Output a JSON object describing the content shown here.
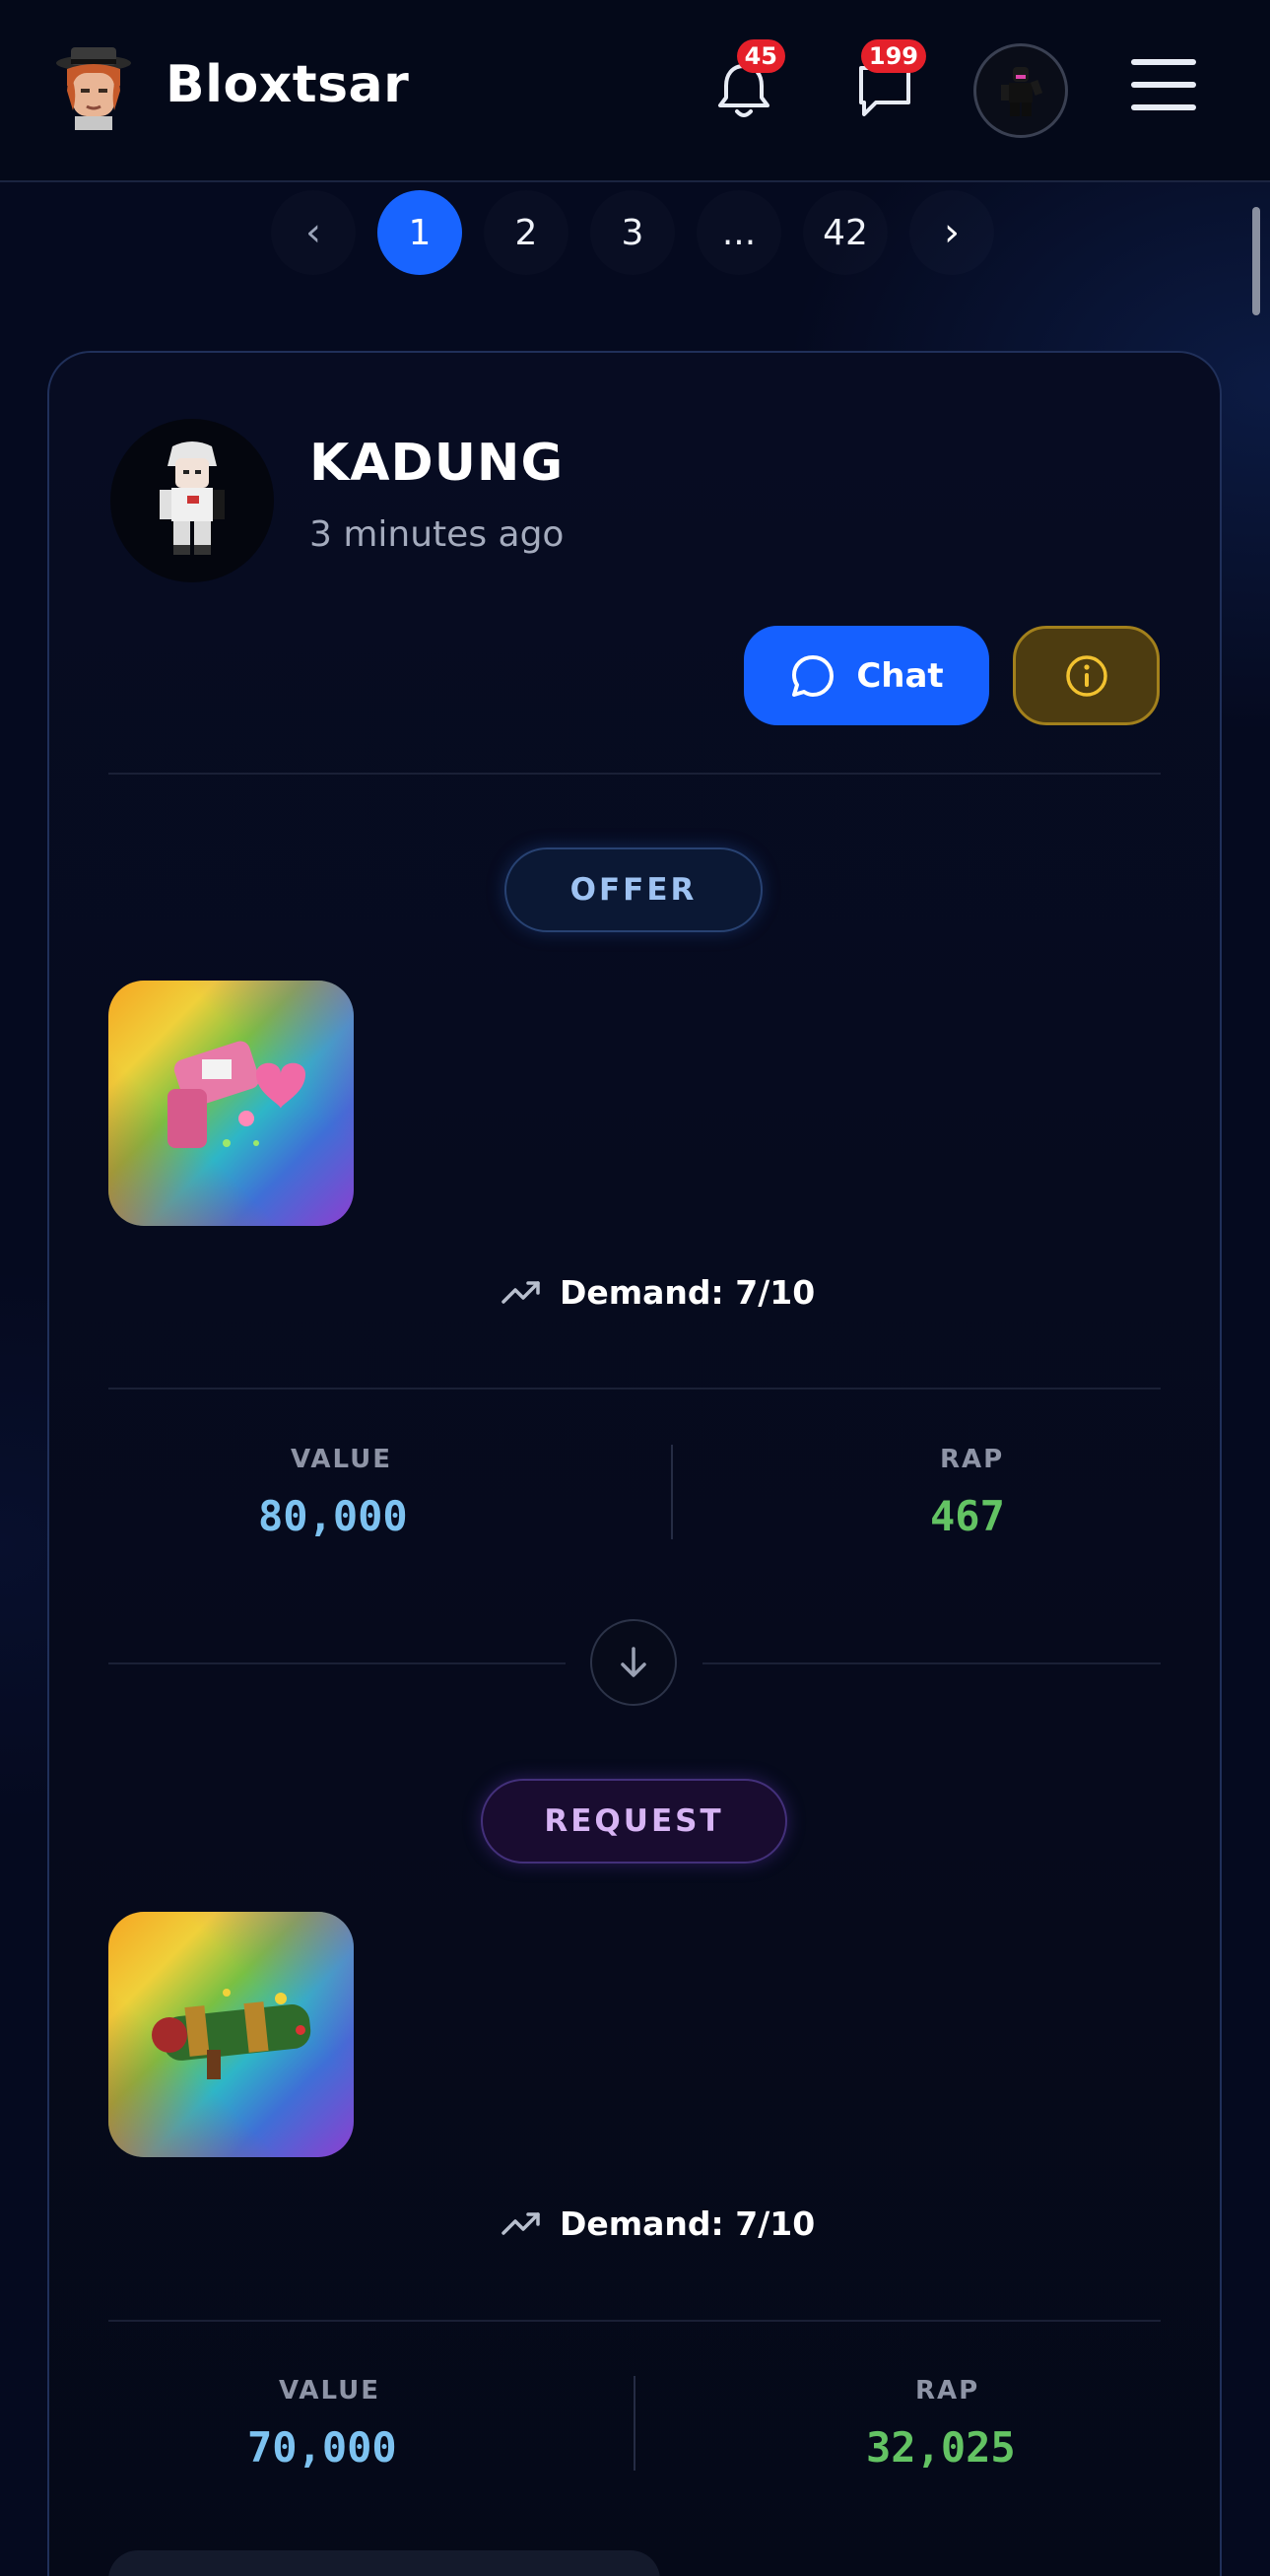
{
  "header": {
    "brand": "Bloxtsar",
    "notifications_count": "45",
    "messages_count": "199",
    "icons": [
      "bell-icon",
      "chat-bubble-icon",
      "hamburger-menu-icon"
    ]
  },
  "pagination": {
    "prev": "‹",
    "pages": [
      "1",
      "2",
      "3",
      "...",
      "42"
    ],
    "active_page": "1",
    "next": "›"
  },
  "trade": {
    "username": "KADUNG",
    "time_ago": "3 minutes ago",
    "chat_label": "Chat",
    "offer": {
      "label": "OFFER",
      "demand": "Demand: 7/10",
      "value_label": "VALUE",
      "value": "80,000",
      "rap_label": "RAP",
      "rap": "467"
    },
    "request": {
      "label": "REQUEST",
      "demand": "Demand: 7/10",
      "value_label": "VALUE",
      "value": "70,000",
      "rap_label": "RAP",
      "rap": "32,025"
    }
  },
  "colors": {
    "accent_blue": "#1560ff",
    "value_blue": "#7dc2f0",
    "rap_green": "#63c363",
    "info_gold": "#a2801c",
    "badge_red": "#e5202a"
  }
}
